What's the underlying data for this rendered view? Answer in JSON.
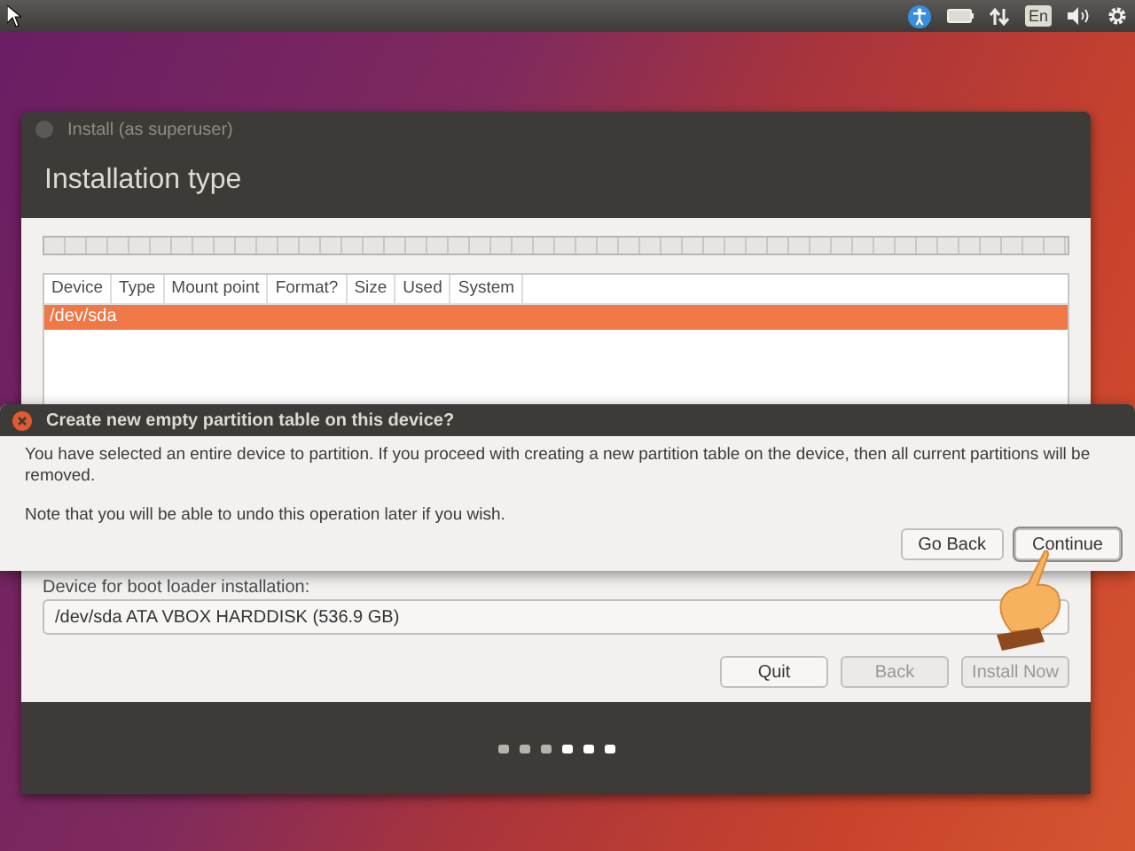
{
  "top_panel": {
    "keyboard_layout": "En"
  },
  "installer": {
    "title": "Install (as superuser)",
    "heading": "Installation type",
    "table": {
      "columns": [
        "Device",
        "Type",
        "Mount point",
        "Format?",
        "Size",
        "Used",
        "System"
      ],
      "rows": [
        {
          "device": "/dev/sda",
          "selected": true
        }
      ]
    },
    "boot_loader": {
      "label": "Device for boot loader installation:",
      "value": "/dev/sda ATA VBOX HARDDISK (536.9 GB)"
    },
    "buttons": [
      {
        "label": "Quit",
        "disabled": false
      },
      {
        "label": "Back",
        "disabled": true
      },
      {
        "label": "Install Now",
        "disabled": true
      }
    ],
    "steps": [
      {
        "completed": true
      },
      {
        "completed": true
      },
      {
        "completed": true
      },
      {
        "completed": false
      },
      {
        "completed": false
      },
      {
        "completed": false
      }
    ]
  },
  "dialog": {
    "title": "Create new empty partition table on this device?",
    "message": "You have selected an entire device to partition. If you proceed with creating a new partition table on the device, then all current partitions will be removed.",
    "note": "Note that you will be able to undo this operation later if you wish.",
    "buttons": [
      {
        "label": "Go Back",
        "focused": false
      },
      {
        "label": "Continue",
        "focused": true
      }
    ]
  }
}
